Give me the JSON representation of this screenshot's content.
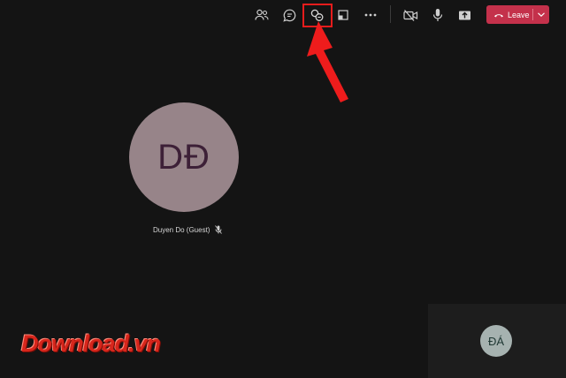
{
  "toolbar": {
    "icons": [
      "people-icon",
      "chat-icon",
      "breakout-rooms-icon",
      "share-tray-icon",
      "more-options-icon",
      "camera-off-icon",
      "microphone-icon",
      "share-screen-icon"
    ],
    "leave_label": "Leave"
  },
  "annotation": {
    "highlight_color": "#e51c1c"
  },
  "main_participant": {
    "initials": "DĐ",
    "name": "Duyen Do (Guest)",
    "avatar_bg": "#978489",
    "initials_color": "#3d2037"
  },
  "self_view": {
    "initials": "ĐÁ",
    "avatar_bg": "#a6b2b0"
  },
  "watermark": {
    "text": "Download.vn",
    "color": "#d7261c"
  },
  "colors": {
    "background": "#141414",
    "leave_button": "#c4314b"
  }
}
